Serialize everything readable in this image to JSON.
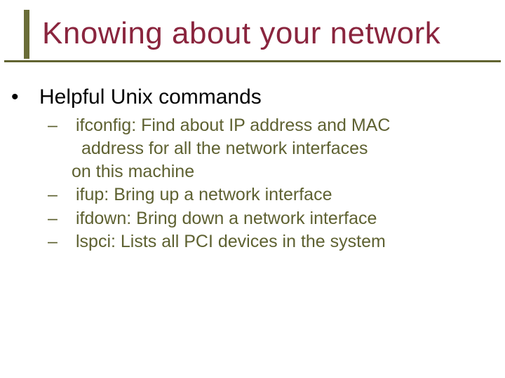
{
  "title": "Knowing about your network",
  "body": {
    "l1": {
      "bullet": "•",
      "text": "Helpful Unix commands"
    },
    "items": [
      {
        "dash": "–",
        "line1": "ifconfig: Find about IP address and MAC",
        "line2": "address for all the network interfaces",
        "line3": "on this machine"
      },
      {
        "dash": "–",
        "line1": "ifup: Bring up a network interface"
      },
      {
        "dash": "–",
        "line1": "ifdown: Bring down a network interface"
      },
      {
        "dash": "–",
        "line1": "lspci: Lists all PCI devices in the system"
      }
    ]
  }
}
